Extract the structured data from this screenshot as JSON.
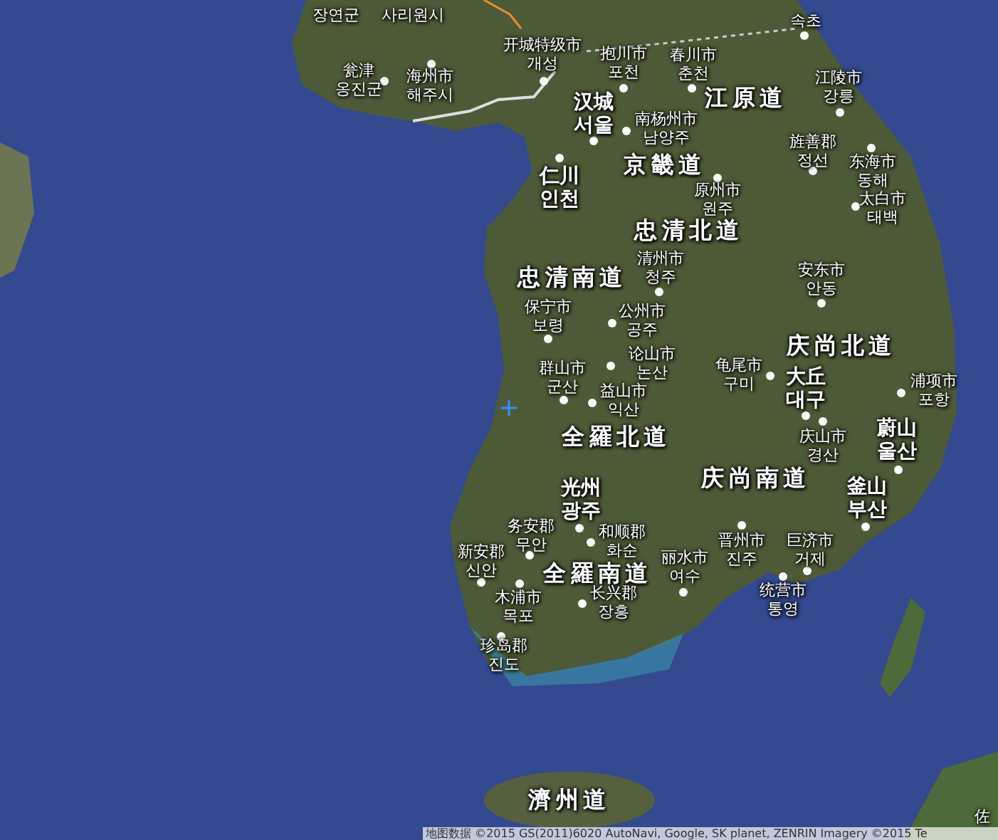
{
  "map": {
    "labels": [
      {
        "kind": "city",
        "lines": [
          "장연군"
        ]
      },
      {
        "kind": "city",
        "lines": [
          "사리원시"
        ]
      },
      {
        "kind": "city",
        "lines": [
          "开城特级市",
          "개성"
        ]
      },
      {
        "kind": "city",
        "lines": [
          "抱川市",
          "포천"
        ]
      },
      {
        "kind": "city",
        "lines": [
          "春川市",
          "춘천"
        ]
      },
      {
        "kind": "city",
        "lines": [
          "속초"
        ]
      },
      {
        "kind": "city",
        "lines": [
          "瓮津",
          "옹진군"
        ]
      },
      {
        "kind": "city",
        "lines": [
          "海州市",
          "해주시"
        ]
      },
      {
        "kind": "city",
        "lines": [
          "江陵市",
          "강릉"
        ]
      },
      {
        "kind": "capital",
        "lines": [
          "汉城",
          "서울"
        ]
      },
      {
        "kind": "city",
        "lines": [
          "南杨州市",
          "남양주"
        ]
      },
      {
        "kind": "province",
        "lines": [
          "江原道"
        ]
      },
      {
        "kind": "city",
        "lines": [
          "旌善郡",
          "정선"
        ]
      },
      {
        "kind": "city",
        "lines": [
          "东海市",
          "동해"
        ]
      },
      {
        "kind": "city",
        "lines": [
          "太白市",
          "태백"
        ]
      },
      {
        "kind": "province",
        "lines": [
          "京畿道"
        ]
      },
      {
        "kind": "capital",
        "lines": [
          "仁川",
          "인천"
        ]
      },
      {
        "kind": "city",
        "lines": [
          "原州市",
          "원주"
        ]
      },
      {
        "kind": "province",
        "lines": [
          "忠清北道"
        ]
      },
      {
        "kind": "province",
        "lines": [
          "忠清南道"
        ]
      },
      {
        "kind": "city",
        "lines": [
          "清州市",
          "청주"
        ]
      },
      {
        "kind": "city",
        "lines": [
          "安东市",
          "안동"
        ]
      },
      {
        "kind": "city",
        "lines": [
          "保宁市",
          "보령"
        ]
      },
      {
        "kind": "city",
        "lines": [
          "公州市",
          "공주"
        ]
      },
      {
        "kind": "province",
        "lines": [
          "庆尚北道"
        ]
      },
      {
        "kind": "city",
        "lines": [
          "论山市",
          "논산"
        ]
      },
      {
        "kind": "city",
        "lines": [
          "群山市",
          "군산"
        ]
      },
      {
        "kind": "city",
        "lines": [
          "龟尾市",
          "구미"
        ]
      },
      {
        "kind": "capital",
        "lines": [
          "大丘",
          "대구"
        ]
      },
      {
        "kind": "city",
        "lines": [
          "浦项市",
          "포항"
        ]
      },
      {
        "kind": "city",
        "lines": [
          "益山市",
          "익산"
        ]
      },
      {
        "kind": "province",
        "lines": [
          "全羅北道"
        ]
      },
      {
        "kind": "city",
        "lines": [
          "庆山市",
          "경산"
        ]
      },
      {
        "kind": "capital",
        "lines": [
          "蔚山",
          "울산"
        ]
      },
      {
        "kind": "province",
        "lines": [
          "庆尚南道"
        ]
      },
      {
        "kind": "capital",
        "lines": [
          "釜山",
          "부산"
        ]
      },
      {
        "kind": "capital",
        "lines": [
          "光州",
          "광주"
        ]
      },
      {
        "kind": "city",
        "lines": [
          "务安郡",
          "무안"
        ]
      },
      {
        "kind": "city",
        "lines": [
          "和顺郡",
          "화순"
        ]
      },
      {
        "kind": "city",
        "lines": [
          "新安郡",
          "신안"
        ]
      },
      {
        "kind": "city",
        "lines": [
          "晋州市",
          "진주"
        ]
      },
      {
        "kind": "city",
        "lines": [
          "巨济市",
          "거제"
        ]
      },
      {
        "kind": "province",
        "lines": [
          "全羅南道"
        ]
      },
      {
        "kind": "city",
        "lines": [
          "丽水市",
          "여수"
        ]
      },
      {
        "kind": "city",
        "lines": [
          "木浦市",
          "목포"
        ]
      },
      {
        "kind": "city",
        "lines": [
          "长兴郡",
          "장흥"
        ]
      },
      {
        "kind": "city",
        "lines": [
          "统营市",
          "통영"
        ]
      },
      {
        "kind": "city",
        "lines": [
          "珍岛郡",
          "진도"
        ]
      },
      {
        "kind": "province",
        "lines": [
          "濟州道"
        ]
      },
      {
        "kind": "city",
        "lines": [
          "佐"
        ]
      }
    ],
    "attribution": "地图数据 ©2015 GS(2011)6020 AutoNavi, Google, SK planet, ZENRIN Imagery ©2015 Te"
  }
}
